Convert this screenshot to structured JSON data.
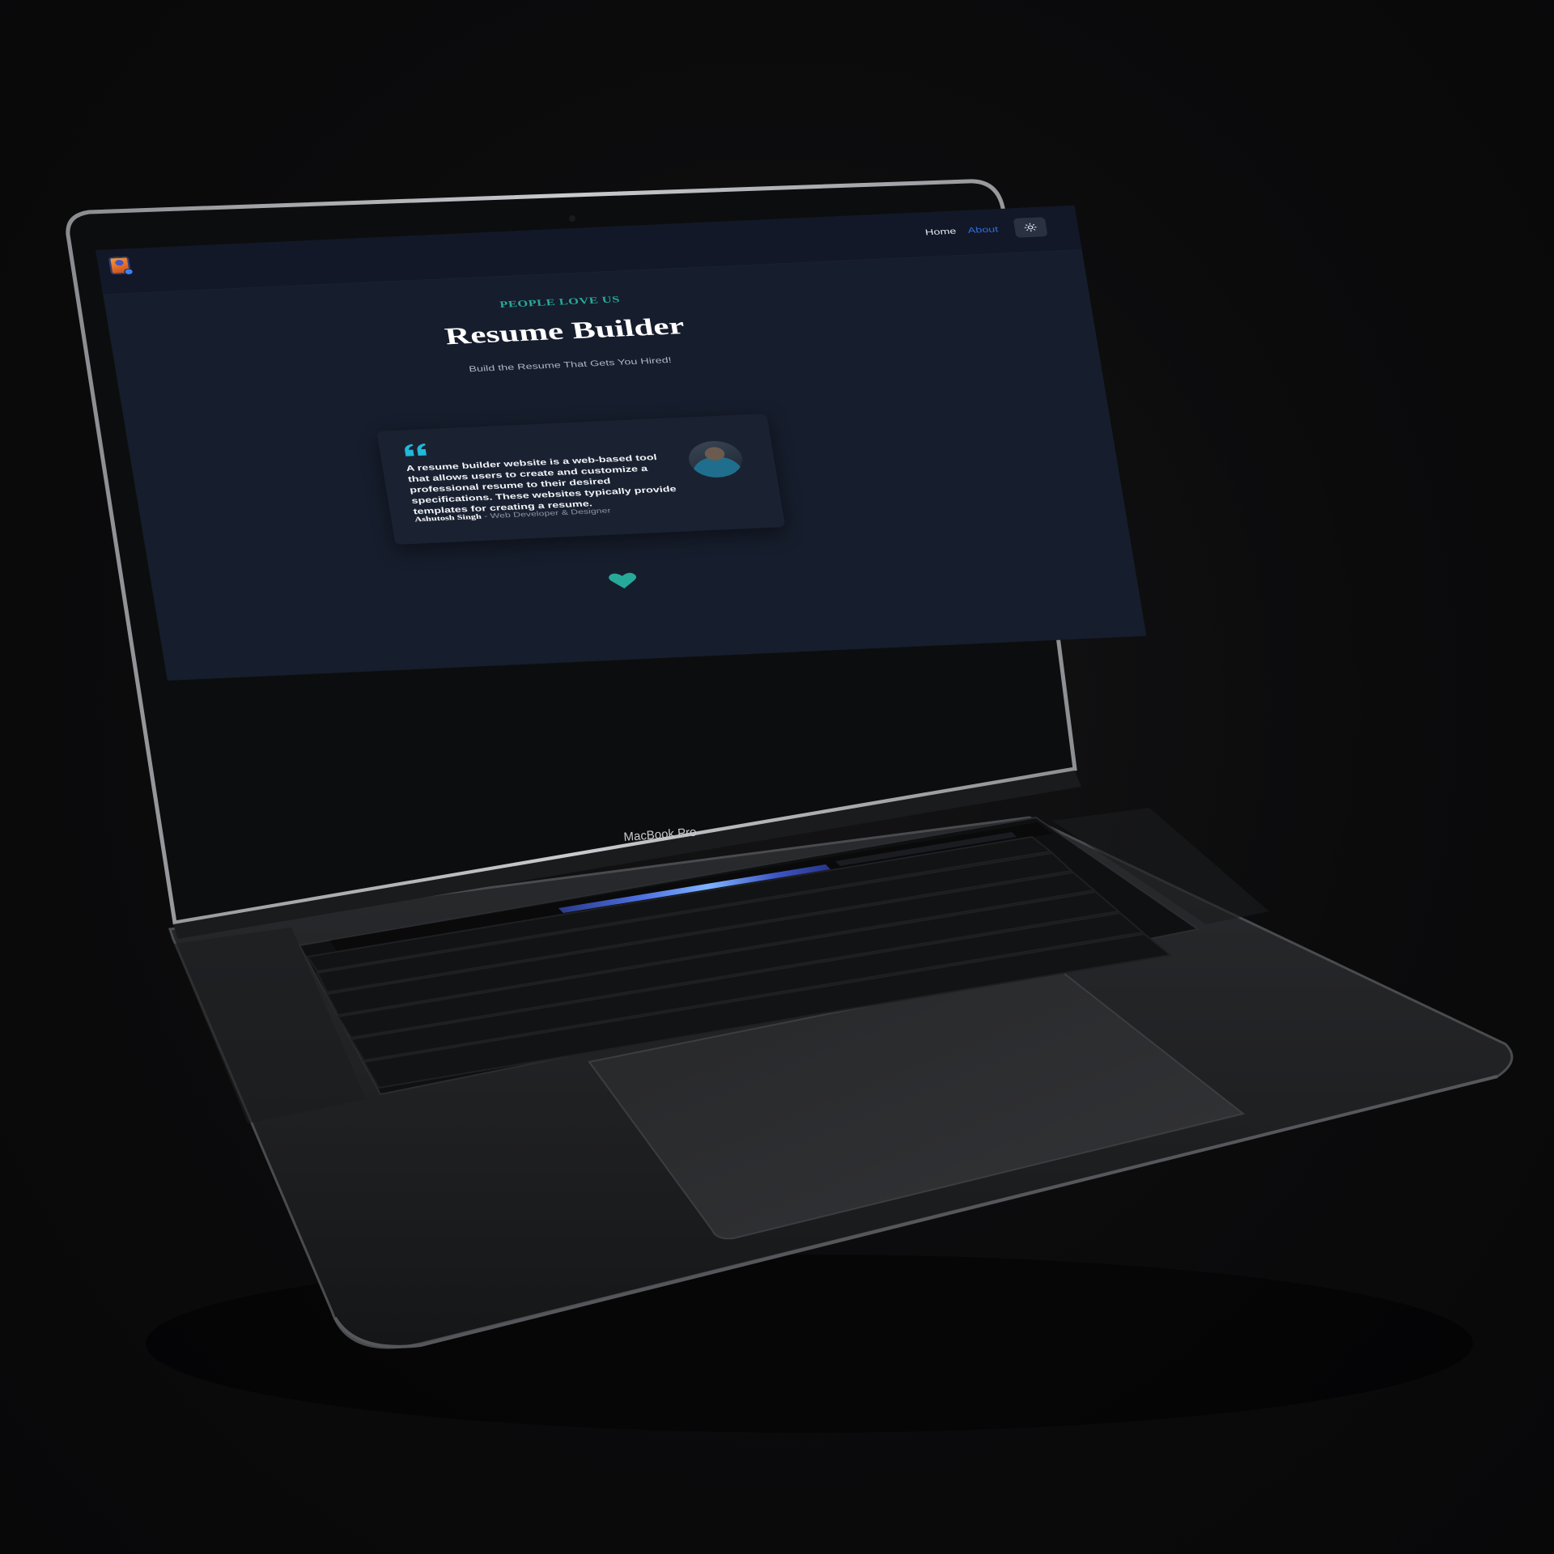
{
  "laptop": {
    "brand_label": "MacBook Pro"
  },
  "navbar": {
    "links": [
      {
        "label": "Home",
        "active": false
      },
      {
        "label": "About",
        "active": true
      }
    ],
    "theme_toggle_icon": "sun-icon",
    "logo_icon": "resume-logo-icon"
  },
  "hero": {
    "eyebrow": "PEOPLE LOVE US",
    "title": "Resume Builder",
    "subtitle": "Build the Resume That Gets You Hired!"
  },
  "testimonial": {
    "quote_icon": "quote-icon",
    "text": "A resume builder website is a web-based tool that allows users to create and customize a professional resume to their desired specifications. These websites typically provide templates for creating a resume.",
    "author": "Ashutosh Singh",
    "role": " - Web Developer & Designer",
    "avatar_icon": "avatar"
  },
  "footer_icon": "heart-icon",
  "colors": {
    "background": "#161d2c",
    "navbar": "#121828",
    "accent_teal": "#27a99a",
    "link_blue": "#2f6fe0",
    "quote_cyan": "#22b8d8"
  }
}
